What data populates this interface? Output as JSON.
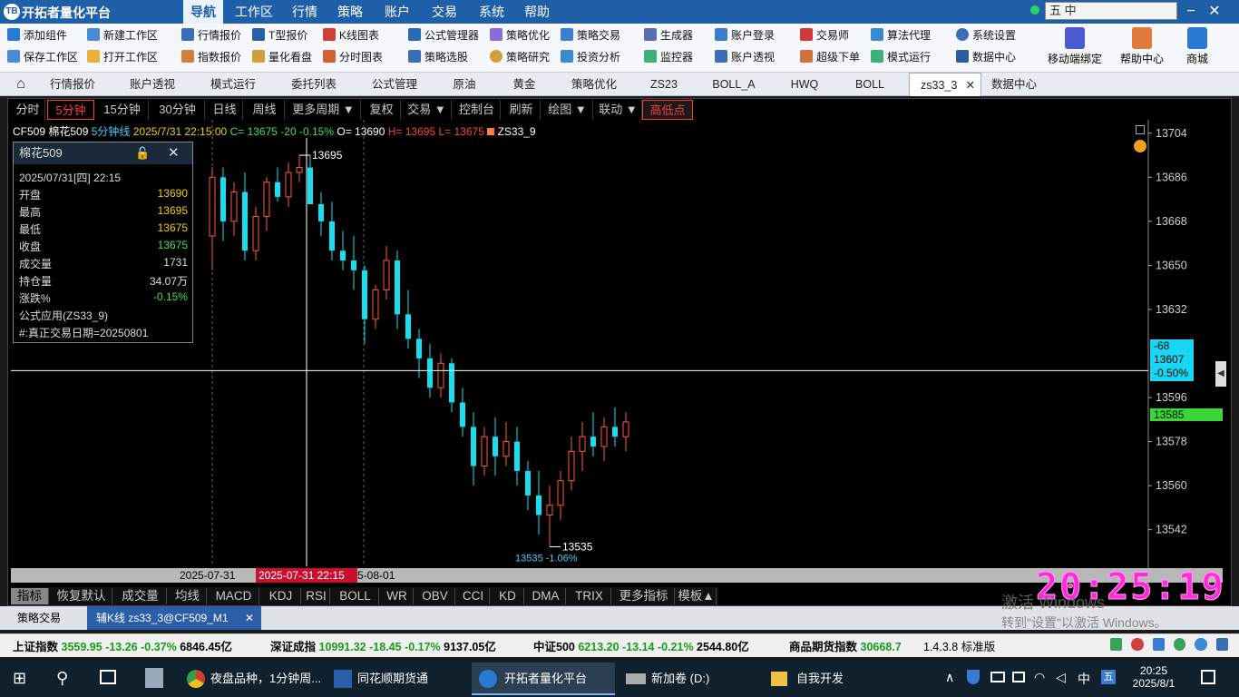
{
  "app": {
    "title": "开拓者量化平台",
    "logo": "TB"
  },
  "menu": [
    "导航",
    "工作区",
    "行情",
    "策略",
    "账户",
    "交易",
    "系统",
    "帮助"
  ],
  "ime_bar": "五 中",
  "toolbar": {
    "row1": [
      "添加组件",
      "新建工作区",
      "行情报价",
      "T型报价",
      "K线图表",
      "公式管理器",
      "策略优化",
      "策略交易",
      "生成器",
      "账户登录",
      "交易师",
      "算法代理",
      "系统设置"
    ],
    "row2": [
      "保存工作区",
      "打开工作区",
      "指数报价",
      "量化看盘",
      "分时图表",
      "策略选股",
      "策略研究",
      "投资分析",
      "监控器",
      "账户透视",
      "超级下单",
      "模式运行",
      "数据中心"
    ],
    "big": [
      "移动端绑定",
      "帮助中心",
      "商城"
    ]
  },
  "tabs": [
    "行情报价",
    "账户透视",
    "模式运行",
    "委托列表",
    "公式管理",
    "原油",
    "黄金",
    "策略优化",
    "ZS23",
    "BOLL_A",
    "HWQ",
    "BOLL",
    "zs33_3",
    "数据中心"
  ],
  "active_tab": "zs33_3",
  "chart_toolbar": [
    "分时",
    "5分钟",
    "15分钟",
    "30分钟",
    "日线",
    "周线",
    "更多周期 ▼",
    "复权",
    "交易 ▼",
    "控制台",
    "刷新",
    "绘图 ▼",
    "联动 ▼",
    "高低点"
  ],
  "info_line": {
    "symbol": "CF509",
    "name": "棉花509",
    "period": "5分钟线",
    "datetime": "2025/7/31 22:15:00",
    "close": "C= 13675",
    "change": "-20",
    "pct": "-0.15%",
    "open": "O= 13690",
    "high": "H= 13695",
    "low": "L= 13675",
    "formula": "ZS33_9"
  },
  "info_panel": {
    "title": "棉花509",
    "datetime": "2025/07/31[四] 22:15",
    "rows": [
      {
        "label": "开盘",
        "value": "13690"
      },
      {
        "label": "最高",
        "value": "13695"
      },
      {
        "label": "最低",
        "value": "13675"
      },
      {
        "label": "收盘",
        "value": "13675"
      },
      {
        "label": "成交量",
        "value": "1731"
      },
      {
        "label": "持仓量",
        "value": "34.07万"
      },
      {
        "label": "涨跌%",
        "value": "-0.15%"
      }
    ],
    "formula": "公式应用(ZS33_9)",
    "note": "#:真正交易日期=20250801"
  },
  "price_axis": [
    "13704",
    "13686",
    "13668",
    "13650",
    "13632",
    "13596",
    "13578",
    "13560",
    "13542"
  ],
  "crosshair": {
    "diff": "-68",
    "price": "13607",
    "pct": "-0.50%"
  },
  "last_price": "13585",
  "high_label": "13695",
  "low_label": "13535",
  "low_note": "13535 -1.06%",
  "date_axis": [
    "2025-07-31",
    "2025-07-31 22:15",
    "5-08-01"
  ],
  "clock": "20:25:19",
  "indicator_tabs": [
    "指标",
    "恢复默认",
    "成交量",
    "均线",
    "MACD",
    "KDJ",
    "RSI",
    "BOLL",
    "WR",
    "OBV",
    "CCI",
    "KD",
    "DMA",
    "TRIX",
    "更多指标",
    "模板▲"
  ],
  "bottom_tabs": [
    "策略交易",
    "辅K线 zs33_3@CF509_M1"
  ],
  "status": {
    "sh": {
      "name": "上证指数",
      "price": "3559.95",
      "chg": "-13.26",
      "pct": "-0.37%",
      "amt": "6846.45亿"
    },
    "sz": {
      "name": "深证成指",
      "price": "10991.32",
      "chg": "-18.45",
      "pct": "-0.17%",
      "amt": "9137.05亿"
    },
    "zz": {
      "name": "中证500",
      "price": "6213.20",
      "chg": "-13.14",
      "pct": "-0.21%",
      "amt": "2544.80亿"
    },
    "fut": {
      "name": "商品期货指数",
      "price": "30668.7"
    },
    "version": "1.4.3.8 标准版"
  },
  "watermark": [
    "激活 Windows",
    "转到\"设置\"以激活 Windows。"
  ],
  "taskbar": {
    "items": [
      "夜盘品种，1分钟周...",
      "同花顺期货通",
      "开拓者量化平台",
      "新加卷 (D:)",
      "自我开发"
    ],
    "time": "20:25",
    "date": "2025/8/1",
    "ime": "中"
  },
  "candles": [
    [
      13662,
      13690,
      13648,
      13686
    ],
    [
      13686,
      13690,
      13660,
      13668
    ],
    [
      13668,
      13684,
      13662,
      13680
    ],
    [
      13680,
      13688,
      13652,
      13656
    ],
    [
      13656,
      13674,
      13652,
      13670
    ],
    [
      13670,
      13686,
      13664,
      13684
    ],
    [
      13684,
      13690,
      13676,
      13678
    ],
    [
      13678,
      13692,
      13674,
      13688
    ],
    [
      13688,
      13695,
      13684,
      13690
    ],
    [
      13690,
      13695,
      13675,
      13675
    ],
    [
      13675,
      13680,
      13662,
      13668
    ],
    [
      13668,
      13676,
      13652,
      13656
    ],
    [
      13656,
      13664,
      13648,
      13652
    ],
    [
      13652,
      13662,
      13640,
      13648
    ],
    [
      13648,
      13650,
      13618,
      13628
    ],
    [
      13628,
      13642,
      13624,
      13640
    ],
    [
      13640,
      13658,
      13636,
      13652
    ],
    [
      13652,
      13656,
      13624,
      13630
    ],
    [
      13630,
      13640,
      13616,
      13620
    ],
    [
      13620,
      13624,
      13604,
      13612
    ],
    [
      13612,
      13618,
      13596,
      13600
    ],
    [
      13600,
      13614,
      13596,
      13610
    ],
    [
      13610,
      13612,
      13590,
      13594
    ],
    [
      13594,
      13600,
      13580,
      13584
    ],
    [
      13584,
      13590,
      13560,
      13568
    ],
    [
      13568,
      13584,
      13564,
      13580
    ],
    [
      13580,
      13588,
      13564,
      13572
    ],
    [
      13572,
      13586,
      13568,
      13578
    ],
    [
      13578,
      13584,
      13560,
      13566
    ],
    [
      13566,
      13570,
      13550,
      13556
    ],
    [
      13556,
      13566,
      13540,
      13548
    ],
    [
      13548,
      13560,
      13535,
      13552
    ],
    [
      13552,
      13566,
      13546,
      13562
    ],
    [
      13562,
      13580,
      13558,
      13574
    ],
    [
      13574,
      13586,
      13566,
      13580
    ],
    [
      13580,
      13590,
      13572,
      13576
    ],
    [
      13576,
      13588,
      13570,
      13584
    ],
    [
      13584,
      13592,
      13576,
      13580
    ],
    [
      13580,
      13590,
      13574,
      13586
    ]
  ],
  "colors": {
    "up": "#ff5a3c",
    "down": "#16e0f0",
    "grid": "#2c2c2c",
    "axis": "#cfcfcf"
  }
}
